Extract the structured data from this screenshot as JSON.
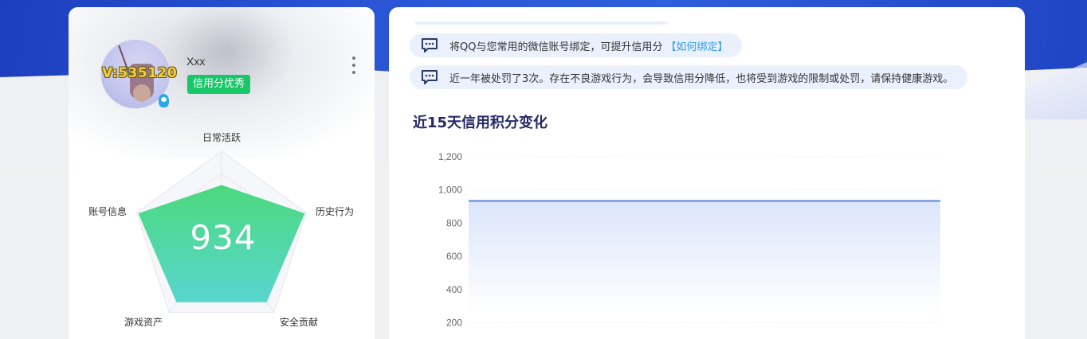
{
  "profile": {
    "username": "Xxx",
    "vip_text": "V:535120",
    "credit_badge": "信用分优秀"
  },
  "radar": {
    "score": "934",
    "labels": {
      "daily": "日常活跃",
      "history": "历史行为",
      "security": "安全贡献",
      "assets": "游戏资产",
      "account": "账号信息"
    },
    "levels": {
      "daily": 0.62,
      "history": 0.98,
      "security": 0.86,
      "assets": 0.86,
      "account": 0.98
    },
    "colors": {
      "fill_top": "#4cd97c",
      "fill_bottom": "#58d6d0",
      "grid": "#e4e6ec"
    }
  },
  "notices": [
    {
      "text": "将QQ与您常用的微信账号绑定，可提升信用分",
      "link": "【如何绑定】"
    },
    {
      "text": "近一年被处罚了3次。存在不良游戏行为，会导致信用分降低，也将受到游戏的限制或处罚，请保持健康游戏。",
      "link": ""
    }
  ],
  "section_title": "近15天信用积分变化",
  "chart_data": {
    "type": "area",
    "title": "近15天信用积分变化",
    "xlabel": "",
    "ylabel": "",
    "ylim": [
      200,
      1200
    ],
    "yticks": [
      "1,200",
      "1,000",
      "800",
      "600",
      "400",
      "200"
    ],
    "ytick_values": [
      1200,
      1000,
      800,
      600,
      400,
      200
    ],
    "grid": true,
    "series": [
      {
        "values": [
          934,
          934,
          934,
          934,
          934,
          934,
          934,
          934,
          934,
          934,
          934,
          934,
          934,
          934,
          934
        ]
      }
    ],
    "line_color": "#5a82e0"
  }
}
